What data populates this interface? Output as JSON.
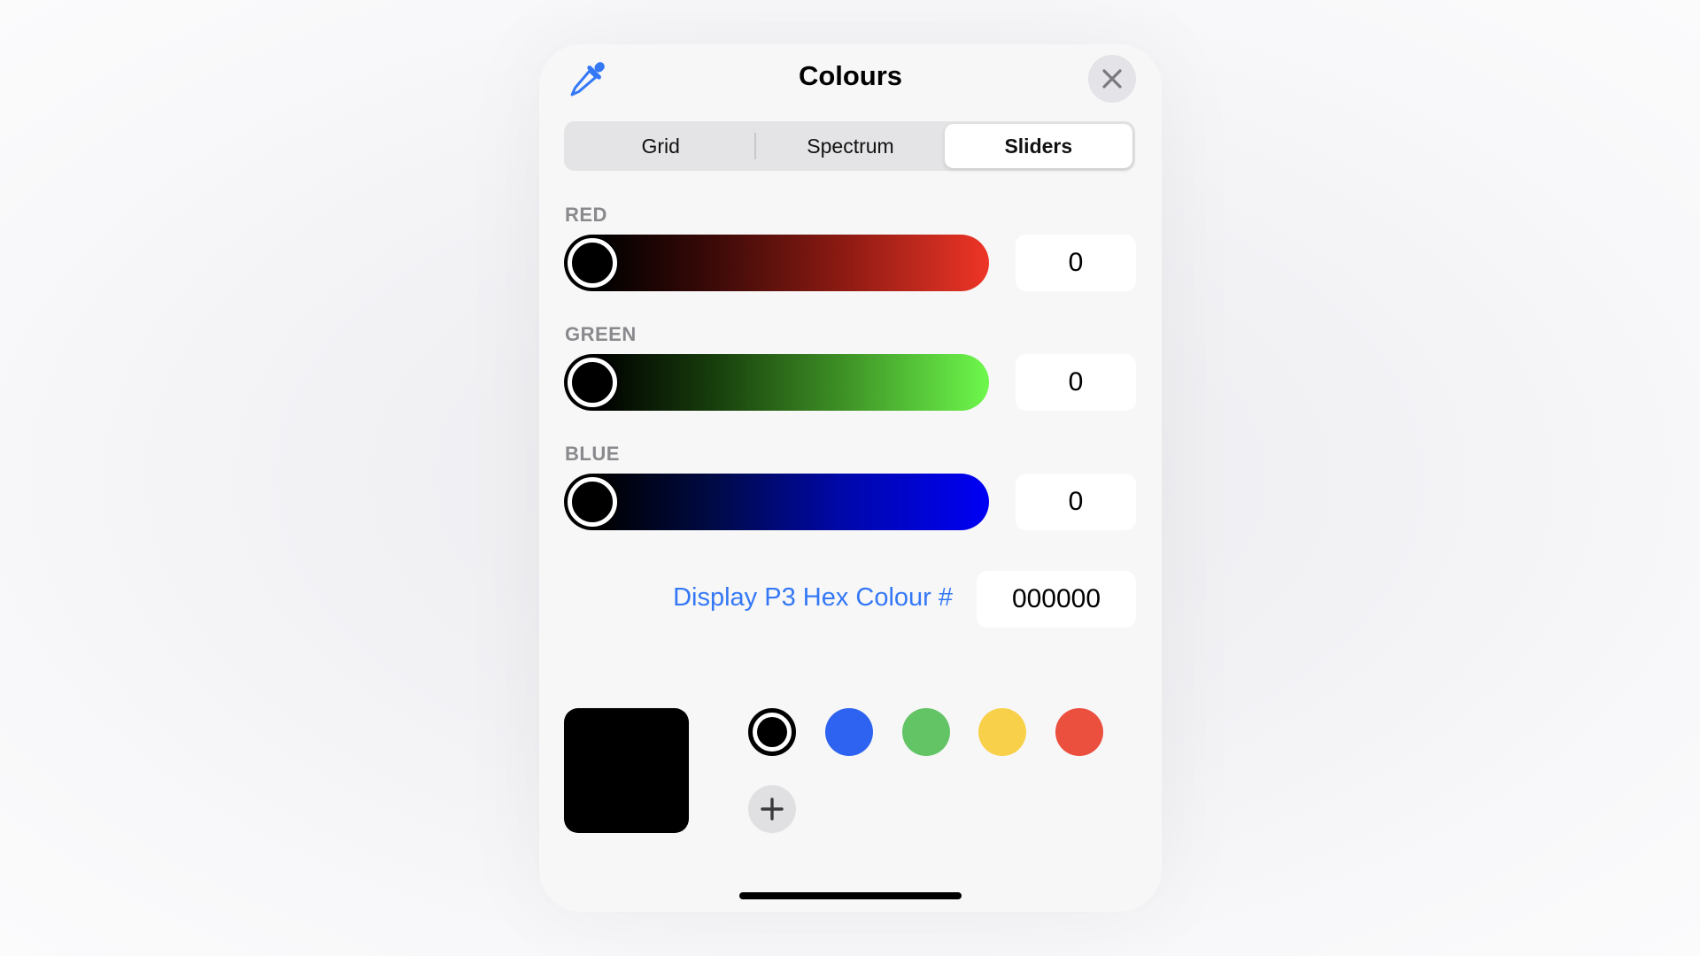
{
  "header": {
    "title": "Colours",
    "icon_left": "eyedropper-icon",
    "icon_right": "close-icon"
  },
  "tabs": [
    {
      "label": "Grid",
      "active": false
    },
    {
      "label": "Spectrum",
      "active": false
    },
    {
      "label": "Sliders",
      "active": true
    }
  ],
  "channels": [
    {
      "label": "RED",
      "value": "0",
      "color": "#ee3527"
    },
    {
      "label": "GREEN",
      "value": "0",
      "color": "#6ef84c"
    },
    {
      "label": "BLUE",
      "value": "0",
      "color": "#0000f5"
    }
  ],
  "hex": {
    "label": "Display P3 Hex Colour #",
    "value": "000000"
  },
  "current_colour": "#000000",
  "presets": [
    {
      "color": "#000000",
      "selected": true
    },
    {
      "color": "#2d63f0"
    },
    {
      "color": "#63c466"
    },
    {
      "color": "#f9d04a"
    },
    {
      "color": "#eb4f3e"
    }
  ],
  "add_icon": "plus-icon",
  "accent_color": "#3478f6"
}
